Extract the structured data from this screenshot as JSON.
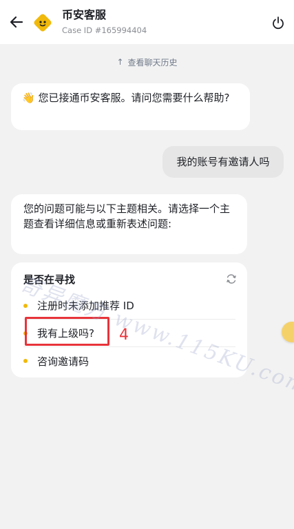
{
  "header": {
    "title": "币安客服",
    "case_id": "Case ID #165994404",
    "back_icon": "arrow-left-icon",
    "power_icon": "power-icon",
    "avatar_color": "#f0b90b"
  },
  "history": {
    "icon": "arrow-up-icon",
    "label": "查看聊天历史"
  },
  "messages": [
    {
      "sender": "agent",
      "emoji": "👋",
      "text": "您已接通币安客服。请问您需要什么帮助?"
    },
    {
      "sender": "user",
      "text": "我的账号有邀请人吗"
    },
    {
      "sender": "agent",
      "text": "您的问题可能与以下主题相关。请选择一个主题查看详细信息或重新表述问题:"
    }
  ],
  "suggestions": {
    "title": "是否在寻找",
    "refresh_icon": "refresh-icon",
    "options": [
      "注册时未添加推荐 ID",
      "我有上级吗?",
      "咨询邀请码"
    ]
  },
  "annotation": {
    "number": "4",
    "color": "#e8333a"
  },
  "watermark": "奇异魔方 www.115KU.com"
}
